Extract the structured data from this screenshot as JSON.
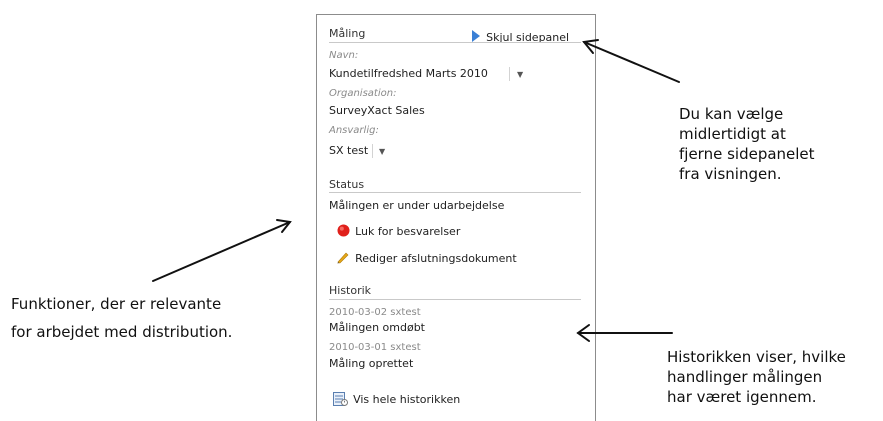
{
  "panel": {
    "title": "Måling",
    "hide_link": "Skjul sidepanel",
    "name_label": "Navn:",
    "name_value": "Kundetilfredshed Marts 2010",
    "org_label": "Organisation:",
    "org_value": "SurveyXact Sales",
    "resp_label": "Ansvarlig:",
    "resp_value": "SX test",
    "status_header": "Status",
    "status_text": "Målingen er under udarbejdelse",
    "close_action": "Luk for besvarelser",
    "edit_action": "Rediger afslutningsdokument",
    "history_header": "Historik",
    "history": [
      {
        "meta": "2010-03-02  sxtest",
        "text": "Målingen omdøbt"
      },
      {
        "meta": "2010-03-01  sxtest",
        "text": "Måling oprettet"
      }
    ],
    "history_link": "Vis hele historikken"
  },
  "annotations": {
    "right_top": [
      "Du kan vælge",
      "midlertidigt at",
      "fjerne sidepanelet",
      "fra visningen."
    ],
    "left": [
      "Funktioner, der er relevante",
      "for arbejdet med distribution."
    ],
    "right_bottom": [
      "Historikken viser, hvilke",
      "handlinger målingen",
      "har været igennem."
    ]
  },
  "colors": {
    "play_icon": "#3a7fd5",
    "close_icon": "#e0201b",
    "pencil_icon": "#e6a817"
  }
}
